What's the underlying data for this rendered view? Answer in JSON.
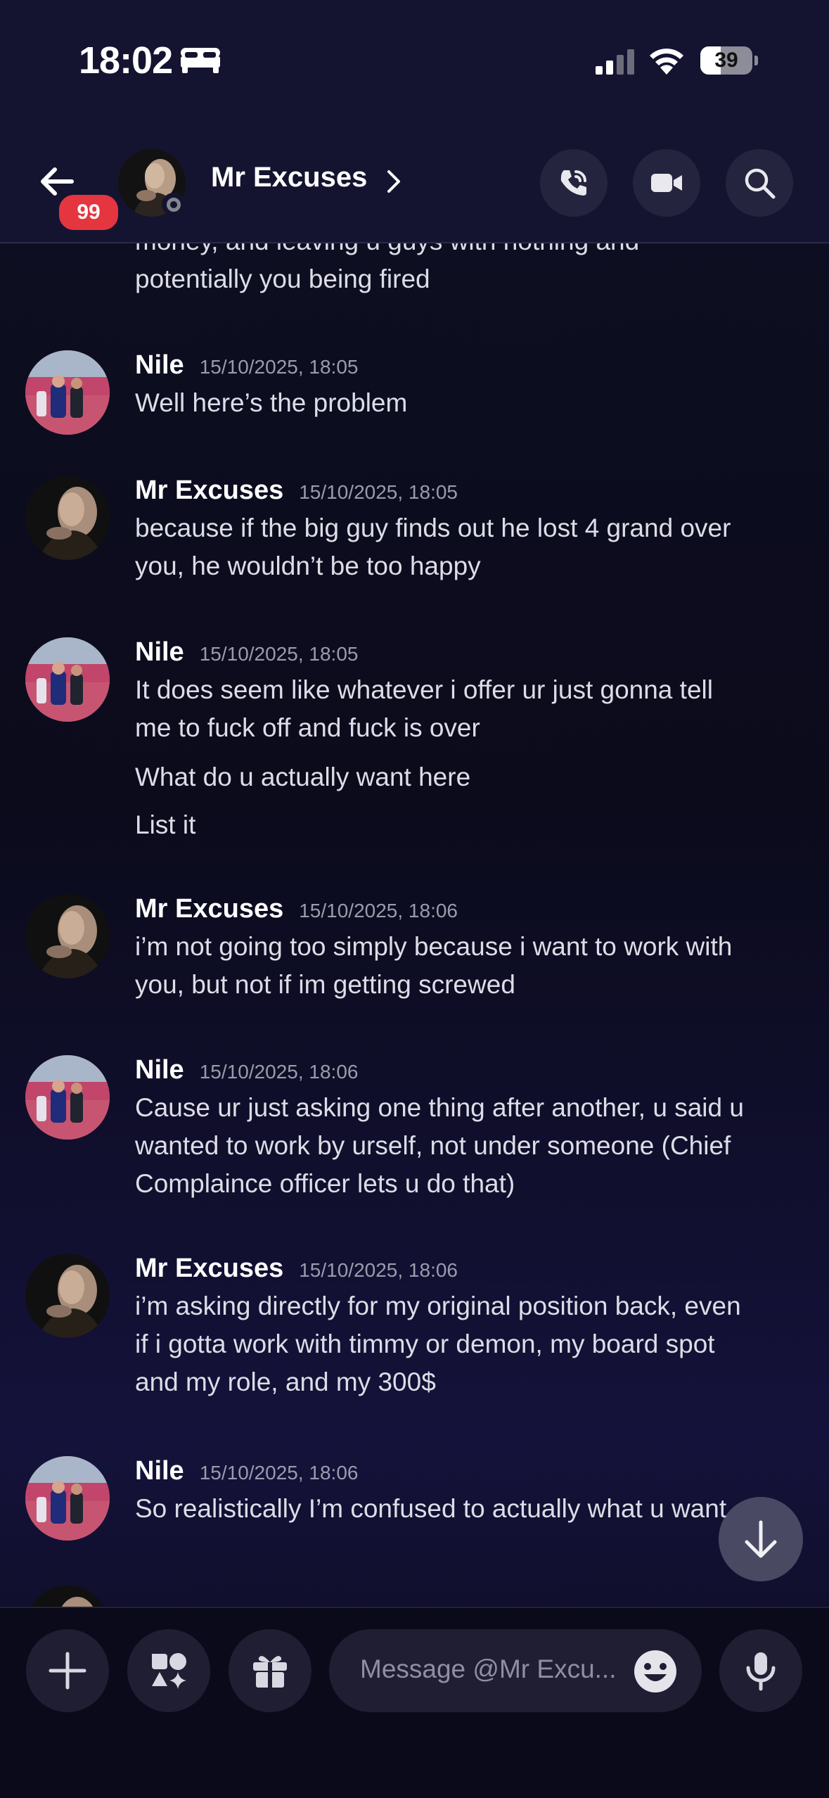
{
  "status_bar": {
    "time": "18:02",
    "battery": "39",
    "battery_level": 0.39
  },
  "header": {
    "back_badge": "99",
    "title": "Mr Excuses"
  },
  "messages": {
    "partial": {
      "lines": [
        "money, and leaving u guys with nothing and",
        "potentially you being fired"
      ]
    },
    "groups": [
      {
        "author": "Nile",
        "timestamp": "15/10/2025, 18:05",
        "lines": [
          "Well here’s the problem"
        ]
      },
      {
        "author": "Mr Excuses",
        "timestamp": "15/10/2025, 18:05",
        "lines": [
          "because if the big guy finds out he lost 4 grand over",
          "you, he wouldn’t be too happy"
        ]
      },
      {
        "author": "Nile",
        "timestamp": "15/10/2025, 18:05",
        "lines": [
          "It does seem like whatever i offer ur just gonna tell",
          "me to fuck off and fuck is over",
          "What do u actually want here",
          "List it"
        ]
      },
      {
        "author": "Mr Excuses",
        "timestamp": "15/10/2025, 18:06",
        "lines": [
          "i’m not going too simply because i want to work with",
          "you, but not if im getting screwed"
        ]
      },
      {
        "author": "Nile",
        "timestamp": "15/10/2025, 18:06",
        "lines": [
          "Cause ur just asking one thing after another, u said u",
          "wanted to work by urself, not under someone (Chief",
          "Complaince officer lets u do that)"
        ]
      },
      {
        "author": "Mr Excuses",
        "timestamp": "15/10/2025, 18:06",
        "lines": [
          "i’m asking directly for my original position back, even",
          "if i gotta work with timmy or demon, my board spot",
          "and my role, and my 300$"
        ]
      },
      {
        "author": "Nile",
        "timestamp": "15/10/2025, 18:06",
        "lines": [
          "So realistically I’m confused to actually what u want"
        ]
      }
    ]
  },
  "composer": {
    "placeholder": "Message @Mr Excu..."
  },
  "icons": {
    "back": "arrow-left-icon",
    "chevron": "chevron-right-icon",
    "call": "phone-call-icon",
    "video": "video-camera-icon",
    "search": "search-icon",
    "add": "plus-icon",
    "apps": "apps-icon",
    "gift": "gift-icon",
    "emoji": "emoji-icon",
    "mic": "microphone-icon",
    "scroll_down": "arrow-down-icon"
  },
  "colors": {
    "badge": "#e5353f",
    "background": "#0b0b1c",
    "header": "#141431"
  }
}
